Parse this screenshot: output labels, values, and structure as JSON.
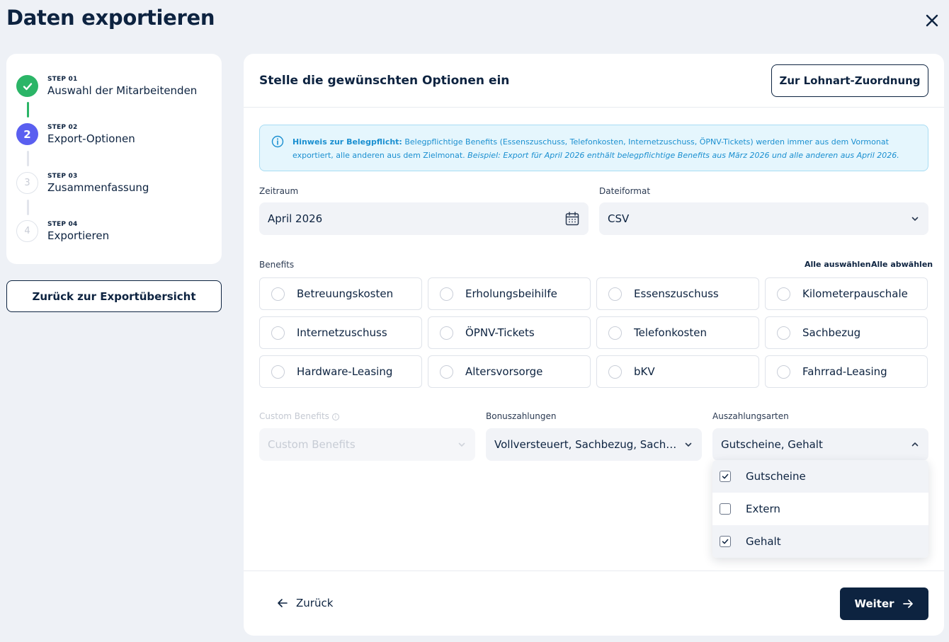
{
  "page": {
    "title": "Daten exportieren"
  },
  "stepper": {
    "steps": [
      {
        "kicker": "STEP 01",
        "label": "Auswahl der Mitarbeitenden",
        "state": "done",
        "number": ""
      },
      {
        "kicker": "STEP 02",
        "label": "Export-Optionen",
        "state": "active",
        "number": "2"
      },
      {
        "kicker": "STEP 03",
        "label": "Zusammenfassung",
        "state": "todo",
        "number": "3"
      },
      {
        "kicker": "STEP 04",
        "label": "Exportieren",
        "state": "todo",
        "number": "4"
      }
    ],
    "back_overview_label": "Zurück zur Exportübersicht"
  },
  "main": {
    "title": "Stelle die gewünschten Optionen ein",
    "lohnart_button": "Zur Lohnart-Zuordnung",
    "notice": {
      "bold": "Hinweis zur Belegpflicht:",
      "text": " Belegpflichtige Benefits (Essenszuschuss, Telefonkosten, Internetzuschuss, ÖPNV-Tickets) werden immer aus dem Vormonat exportiert, alle anderen aus dem Zielmonat. ",
      "italic": "Beispiel: Export für April 2026 enthält belegpflichtige Benefits aus März 2026 und alle anderen aus April 2026."
    },
    "zeitraum": {
      "label": "Zeitraum",
      "value": "April 2026"
    },
    "dateiformat": {
      "label": "Dateiformat",
      "value": "CSV"
    },
    "benefits": {
      "label": "Benefits",
      "select_all": "Alle auswählen",
      "deselect_all": "Alle abwählen",
      "items": [
        "Betreuungskosten",
        "Erholungsbeihilfe",
        "Essenszuschuss",
        "Kilometerpauschale",
        "Internetzuschuss",
        "ÖPNV-Tickets",
        "Telefonkosten",
        "Sachbezug",
        "Hardware-Leasing",
        "Altersvorsorge",
        "bKV",
        "Fahrrad-Leasing"
      ]
    },
    "custom_benefits": {
      "label": "Custom Benefits",
      "placeholder": "Custom Benefits"
    },
    "bonuszahlungen": {
      "label": "Bonuszahlungen",
      "value": "Vollversteuert, Sachbezug, Sachzuwendung"
    },
    "auszahlungsarten": {
      "label": "Auszahlungsarten",
      "value": "Gutscheine, Gehalt",
      "options": [
        {
          "label": "Gutscheine",
          "checked": true
        },
        {
          "label": "Extern",
          "checked": false
        },
        {
          "label": "Gehalt",
          "checked": true
        }
      ]
    },
    "footer": {
      "back_label": "Zurück",
      "next_label": "Weiter"
    }
  },
  "colors": {
    "accent": "#5a5ff0",
    "success": "#2bb567",
    "navy": "#0d2340",
    "info": "#1a8fd0"
  }
}
